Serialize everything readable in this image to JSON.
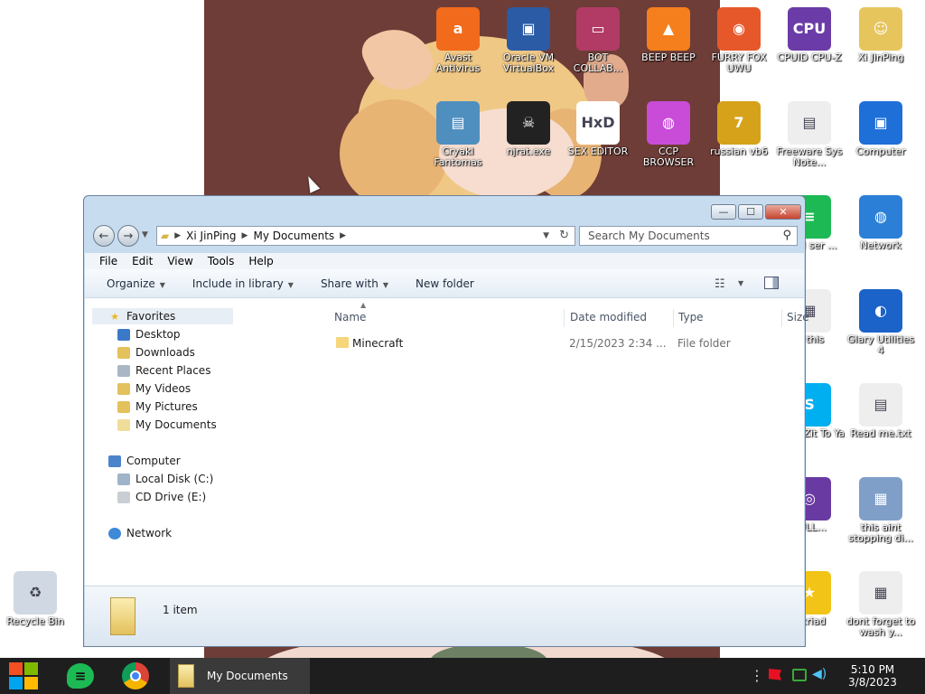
{
  "desktop": {
    "icons": [
      {
        "name": "desktop-icon-avast",
        "label": "Avast Antivirus",
        "icon": "avast-icon",
        "color": "#f26a1b"
      },
      {
        "name": "desktop-icon-virtualbox",
        "label": "Oracle VM VirtualBox",
        "icon": "virtualbox-icon",
        "color": "#2a5ba4"
      },
      {
        "name": "desktop-icon-bot-collab",
        "label": "BOT COLLAB...",
        "icon": "tv-icon",
        "color": "#b13b65"
      },
      {
        "name": "desktop-icon-beep-beep",
        "label": "BEEP BEEP",
        "icon": "vlc-icon",
        "color": "#f47f1c"
      },
      {
        "name": "desktop-icon-furry-fox",
        "label": "FURRY FOX UWU",
        "icon": "firefox-icon",
        "color": "#e6582a"
      },
      {
        "name": "desktop-icon-cpuz",
        "label": "CPUID CPU-Z",
        "icon": "cpuz-icon",
        "color": "#6b3ca8"
      },
      {
        "name": "desktop-icon-xi-jinping",
        "label": "Xi JinPing",
        "icon": "user-folder-icon",
        "color": "#e6c55d"
      },
      {
        "name": "desktop-icon-cryakl",
        "label": "Cryakl Fantomas",
        "icon": "window-icon",
        "color": "#4f8fc0"
      },
      {
        "name": "desktop-icon-njrat",
        "label": "njrat.exe",
        "icon": "skull-icon",
        "color": "#222222"
      },
      {
        "name": "desktop-icon-sex-editor",
        "label": "SEX EDITOR",
        "icon": "hxd-icon",
        "color": "#ffffff"
      },
      {
        "name": "desktop-icon-ccp-browser",
        "label": "CCP BROWSER",
        "icon": "chrome-like-icon",
        "color": "#c84cd8"
      },
      {
        "name": "desktop-icon-russian-vb6",
        "label": "russian vb6",
        "icon": "vb6-icon",
        "color": "#d6a21a"
      },
      {
        "name": "desktop-icon-freeware",
        "label": "Freeware Sys Note...",
        "icon": "document-icon",
        "color": "#eeeeee"
      },
      {
        "name": "desktop-icon-computer",
        "label": "Computer",
        "icon": "computer-icon",
        "color": "#1f6fd8"
      },
      {
        "name": "desktop-icon-used-user",
        "label": "used ser ...",
        "icon": "spotify-icon",
        "color": "#1db954"
      },
      {
        "name": "desktop-icon-network",
        "label": "Network",
        "icon": "network-icon",
        "color": "#2b7fd6"
      },
      {
        "name": "desktop-icon-this-this",
        "label": "is this",
        "icon": "calendar-doc-icon",
        "color": "#eeeeee"
      },
      {
        "name": "desktop-icon-glary",
        "label": "Glary Utilities 4",
        "icon": "glary-icon",
        "color": "#1b62c9"
      },
      {
        "name": "desktop-icon-skype",
        "label": "What Zit To Ya",
        "icon": "skype-icon",
        "color": "#00aff0"
      },
      {
        "name": "desktop-icon-readme",
        "label": "Read me.txt",
        "icon": "text-doc-icon",
        "color": "#eeeeee"
      },
      {
        "name": "desktop-icon-dvd",
        "label": "SULL...",
        "icon": "dvd-icon",
        "color": "#6a3aa3"
      },
      {
        "name": "desktop-icon-this-aint",
        "label": "this aint stopping di...",
        "icon": "installer-icon",
        "color": "#7f9fc9"
      },
      {
        "name": "desktop-icon-star",
        "label": "n triad",
        "icon": "star-icon",
        "color": "#f2c418"
      },
      {
        "name": "desktop-icon-dont-forget",
        "label": "dont forget to wash y...",
        "icon": "calendar-doc-icon",
        "color": "#eeeeee"
      },
      {
        "name": "desktop-icon-recycle-bin",
        "label": "Recycle Bin",
        "icon": "recycle-bin-icon",
        "color": "#cfd8e3"
      }
    ]
  },
  "window": {
    "title_buttons": {
      "minimize": "—",
      "maximize": "☐",
      "close": "✕"
    },
    "address": {
      "root_icon": "folder-icon",
      "segments": [
        "Xi JinPing",
        "My Documents"
      ]
    },
    "search": {
      "placeholder": "Search My Documents"
    },
    "menu": [
      "File",
      "Edit",
      "View",
      "Tools",
      "Help"
    ],
    "toolbar": {
      "organize": "Organize",
      "include": "Include in library",
      "share": "Share with",
      "new_folder": "New folder"
    },
    "navpane": {
      "favorites": "Favorites",
      "fav_items": [
        "Desktop",
        "Downloads",
        "Recent Places",
        "My Videos",
        "My Pictures",
        "My Documents"
      ],
      "computer": "Computer",
      "computer_items": [
        "Local Disk (C:)",
        "CD Drive (E:)"
      ],
      "network": "Network"
    },
    "columns": {
      "name": "Name",
      "date": "Date modified",
      "type": "Type",
      "size": "Size"
    },
    "files": [
      {
        "name": "Minecraft",
        "date": "2/15/2023 2:34 ...",
        "type": "File folder",
        "size": ""
      }
    ],
    "details": {
      "count": "1 item"
    }
  },
  "taskbar": {
    "active_task": "My Documents",
    "time": "5:10 PM",
    "date": "3/8/2023"
  }
}
